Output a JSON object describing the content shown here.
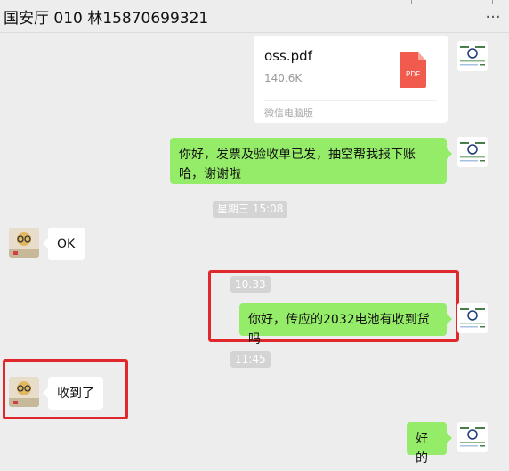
{
  "window": {
    "title": "国安厅 010  林15870699321",
    "more_icon": "more-icon"
  },
  "messages": {
    "file": {
      "name": "oss.pdf",
      "size": "140.6K",
      "source": "微信电脑版",
      "icon_label": "PDF"
    },
    "invoice_text": "你好，发票及验收单已发，抽空帮我报下账哈，谢谢啦",
    "time1": "星期三 15:08",
    "ok_text": "OK",
    "time2": "10:33",
    "battery_text": "你好，传应的2032电池有收到货吗",
    "time3": "11:45",
    "received_text": "收到了",
    "reply_text": "好的"
  },
  "colors": {
    "sent_bubble": "#95ec69",
    "received_bubble": "#ffffff",
    "highlight_box": "#e0282c",
    "pdf_icon": "#f15b4e"
  }
}
